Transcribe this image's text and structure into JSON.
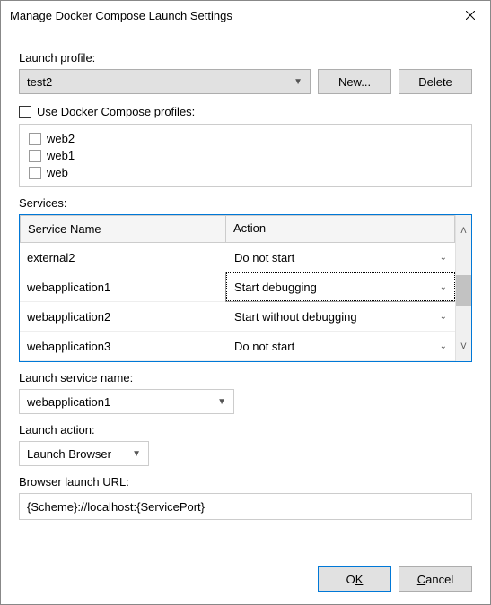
{
  "window": {
    "title": "Manage Docker Compose Launch Settings"
  },
  "labels": {
    "launch_profile": "Launch profile:",
    "use_profiles": "Use Docker Compose profiles:",
    "services": "Services:",
    "launch_service": "Launch service name:",
    "launch_action": "Launch action:",
    "browser_url": "Browser launch URL:"
  },
  "profile_dropdown": {
    "value": "test2"
  },
  "buttons": {
    "new": "New...",
    "delete": "Delete",
    "ok_pre": "O",
    "ok_u": "K",
    "cancel_u": "C",
    "cancel_post": "ancel"
  },
  "profiles": [
    "web2",
    "web1",
    "web"
  ],
  "grid": {
    "col_name": "Service Name",
    "col_action": "Action",
    "rows": [
      {
        "name": "external2",
        "action": "Do not start",
        "focused": false
      },
      {
        "name": "webapplication1",
        "action": "Start debugging",
        "focused": true
      },
      {
        "name": "webapplication2",
        "action": "Start without debugging",
        "focused": false
      },
      {
        "name": "webapplication3",
        "action": "Do not start",
        "focused": false
      }
    ]
  },
  "launch_service": {
    "value": "webapplication1"
  },
  "launch_action": {
    "value": "Launch Browser"
  },
  "browser_url": {
    "value": "{Scheme}://localhost:{ServicePort}"
  }
}
